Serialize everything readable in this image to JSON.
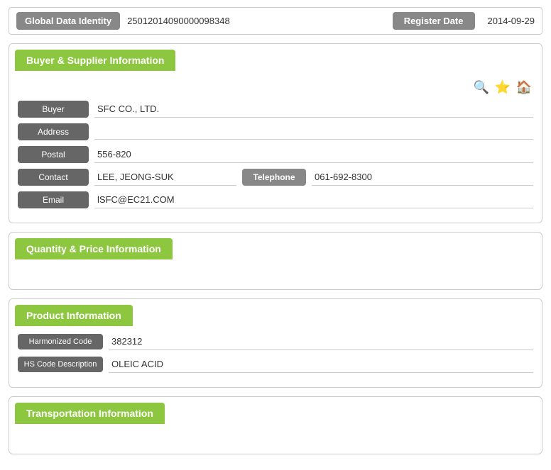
{
  "identity": {
    "label": "Global Data Identity",
    "id_value": "25012014090000098348",
    "reg_label": "Register Date",
    "reg_value": "2014-09-29"
  },
  "buyer_supplier": {
    "section_title": "Buyer & Supplier Information",
    "buyer_label": "Buyer",
    "buyer_value": "SFC CO., LTD.",
    "address_label": "Address",
    "address_value": "",
    "postal_label": "Postal",
    "postal_value": "556-820",
    "contact_label": "Contact",
    "contact_value": "LEE, JEONG-SUK",
    "telephone_label": "Telephone",
    "telephone_value": "061-692-8300",
    "email_label": "Email",
    "email_value": "lSFC@EC21.COM",
    "icons": {
      "search": "🔍",
      "star": "⭐",
      "home": "🏠"
    }
  },
  "quantity_price": {
    "section_title": "Quantity & Price Information"
  },
  "product": {
    "section_title": "Product Information",
    "harmonized_label": "Harmonized Code",
    "harmonized_value": "382312",
    "hs_desc_label": "HS Code Description",
    "hs_desc_value": "OLEIC ACID"
  },
  "transportation": {
    "section_title": "Transportation Information"
  }
}
